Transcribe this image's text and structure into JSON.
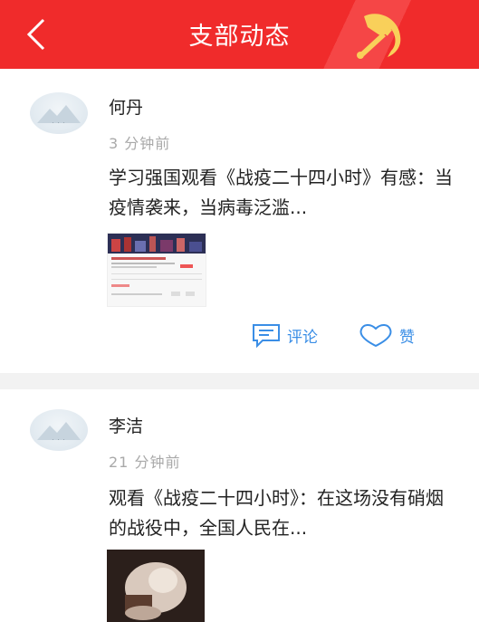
{
  "header": {
    "title": "支部动态"
  },
  "posts": [
    {
      "author": "何丹",
      "time": "3 分钟前",
      "text": "学习强国观看《战疫二十四小时》有感：当疫情袭来，当病毒泛滥...",
      "actions": {
        "comment": "评论",
        "like": "赞"
      }
    },
    {
      "author": "李洁",
      "time": "21 分钟前",
      "text": "观看《战疫二十四小时》：在这场没有硝烟的战役中，全国人民在..."
    }
  ],
  "colors": {
    "header": "#f02b2b",
    "accent": "#3a8ee6",
    "muted": "#a9a9a9",
    "divider": "#f2f2f2"
  },
  "icons": {
    "back": "chevron-left-icon",
    "emblem": "party-emblem-icon",
    "comment": "comment-icon",
    "like": "heart-icon"
  }
}
